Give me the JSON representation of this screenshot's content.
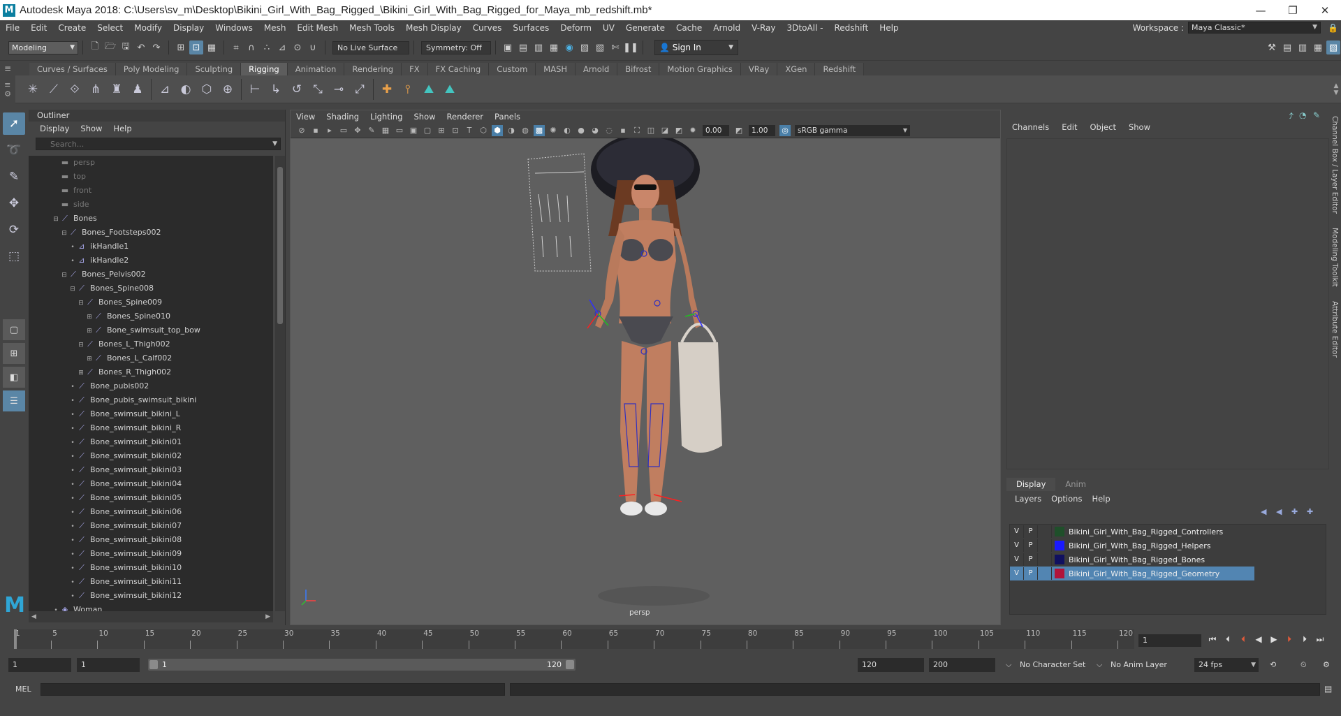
{
  "window": {
    "title": "Autodesk Maya 2018: C:\\Users\\sv_m\\Desktop\\Bikini_Girl_With_Bag_Rigged_\\Bikini_Girl_With_Bag_Rigged_for_Maya_mb_redshift.mb*",
    "logo": "M",
    "minimize": "—",
    "restore": "❐",
    "close": "✕"
  },
  "menubar": {
    "items": [
      "File",
      "Edit",
      "Create",
      "Select",
      "Modify",
      "Display",
      "Windows",
      "Mesh",
      "Edit Mesh",
      "Mesh Tools",
      "Mesh Display",
      "Curves",
      "Surfaces",
      "Deform",
      "UV",
      "Generate",
      "Cache",
      "Arnold",
      "V-Ray",
      "3DtoAll -",
      "Redshift",
      "Help"
    ],
    "workspace_label": "Workspace :",
    "workspace_value": "Maya Classic*"
  },
  "statusline": {
    "mode": "Modeling",
    "live_surface": "No Live Surface",
    "symmetry": "Symmetry: Off",
    "sign_in": "Sign In"
  },
  "shelf": {
    "tabs": [
      "Curves / Surfaces",
      "Poly Modeling",
      "Sculpting",
      "Rigging",
      "Animation",
      "Rendering",
      "FX",
      "FX Caching",
      "Custom",
      "MASH",
      "Arnold",
      "Bifrost",
      "Motion Graphics",
      "VRay",
      "XGen",
      "Redshift"
    ],
    "active_tab": "Rigging"
  },
  "outliner": {
    "title": "Outliner",
    "menu": [
      "Display",
      "Show",
      "Help"
    ],
    "search_placeholder": "Search...",
    "rows": [
      {
        "label": "persp",
        "depth": 0,
        "exp": "",
        "icon": "camera-icon",
        "dim": true
      },
      {
        "label": "top",
        "depth": 0,
        "exp": "",
        "icon": "camera-icon",
        "dim": true
      },
      {
        "label": "front",
        "depth": 0,
        "exp": "",
        "icon": "camera-icon",
        "dim": true
      },
      {
        "label": "side",
        "depth": 0,
        "exp": "",
        "icon": "camera-icon",
        "dim": true
      },
      {
        "label": "Bones",
        "depth": 0,
        "exp": "⊟",
        "icon": "joint-icon",
        "dim": false
      },
      {
        "label": "Bones_Footsteps002",
        "depth": 1,
        "exp": "⊟",
        "icon": "joint-icon",
        "dim": false
      },
      {
        "label": "ikHandle1",
        "depth": 2,
        "exp": "•",
        "icon": "ik-handle-icon",
        "dim": false
      },
      {
        "label": "ikHandle2",
        "depth": 2,
        "exp": "•",
        "icon": "ik-handle-icon",
        "dim": false
      },
      {
        "label": "Bones_Pelvis002",
        "depth": 1,
        "exp": "⊟",
        "icon": "joint-icon",
        "dim": false
      },
      {
        "label": "Bones_Spine008",
        "depth": 2,
        "exp": "⊟",
        "icon": "joint-icon",
        "dim": false
      },
      {
        "label": "Bones_Spine009",
        "depth": 3,
        "exp": "⊟",
        "icon": "joint-icon",
        "dim": false
      },
      {
        "label": "Bones_Spine010",
        "depth": 4,
        "exp": "⊞",
        "icon": "joint-icon",
        "dim": false
      },
      {
        "label": "Bone_swimsuit_top_bow",
        "depth": 4,
        "exp": "⊞",
        "icon": "joint-icon",
        "dim": false
      },
      {
        "label": "Bones_L_Thigh002",
        "depth": 3,
        "exp": "⊟",
        "icon": "joint-icon",
        "dim": false
      },
      {
        "label": "Bones_L_Calf002",
        "depth": 4,
        "exp": "⊞",
        "icon": "joint-icon",
        "dim": false
      },
      {
        "label": "Bones_R_Thigh002",
        "depth": 3,
        "exp": "⊞",
        "icon": "joint-icon",
        "dim": false
      },
      {
        "label": "Bone_pubis002",
        "depth": 2,
        "exp": "•",
        "icon": "joint-icon",
        "dim": false
      },
      {
        "label": "Bone_pubis_swimsuit_bikini",
        "depth": 2,
        "exp": "•",
        "icon": "joint-icon",
        "dim": false
      },
      {
        "label": "Bone_swimsuit_bikini_L",
        "depth": 2,
        "exp": "•",
        "icon": "joint-icon",
        "dim": false
      },
      {
        "label": "Bone_swimsuit_bikini_R",
        "depth": 2,
        "exp": "•",
        "icon": "joint-icon",
        "dim": false
      },
      {
        "label": "Bone_swimsuit_bikini01",
        "depth": 2,
        "exp": "•",
        "icon": "joint-icon",
        "dim": false
      },
      {
        "label": "Bone_swimsuit_bikini02",
        "depth": 2,
        "exp": "•",
        "icon": "joint-icon",
        "dim": false
      },
      {
        "label": "Bone_swimsuit_bikini03",
        "depth": 2,
        "exp": "•",
        "icon": "joint-icon",
        "dim": false
      },
      {
        "label": "Bone_swimsuit_bikini04",
        "depth": 2,
        "exp": "•",
        "icon": "joint-icon",
        "dim": false
      },
      {
        "label": "Bone_swimsuit_bikini05",
        "depth": 2,
        "exp": "•",
        "icon": "joint-icon",
        "dim": false
      },
      {
        "label": "Bone_swimsuit_bikini06",
        "depth": 2,
        "exp": "•",
        "icon": "joint-icon",
        "dim": false
      },
      {
        "label": "Bone_swimsuit_bikini07",
        "depth": 2,
        "exp": "•",
        "icon": "joint-icon",
        "dim": false
      },
      {
        "label": "Bone_swimsuit_bikini08",
        "depth": 2,
        "exp": "•",
        "icon": "joint-icon",
        "dim": false
      },
      {
        "label": "Bone_swimsuit_bikini09",
        "depth": 2,
        "exp": "•",
        "icon": "joint-icon",
        "dim": false
      },
      {
        "label": "Bone_swimsuit_bikini10",
        "depth": 2,
        "exp": "•",
        "icon": "joint-icon",
        "dim": false
      },
      {
        "label": "Bone_swimsuit_bikini11",
        "depth": 2,
        "exp": "•",
        "icon": "joint-icon",
        "dim": false
      },
      {
        "label": "Bone_swimsuit_bikini12",
        "depth": 2,
        "exp": "•",
        "icon": "joint-icon",
        "dim": false
      },
      {
        "label": "Woman",
        "depth": 0,
        "exp": "•",
        "icon": "mesh-icon",
        "dim": false
      }
    ]
  },
  "viewport": {
    "menu": [
      "View",
      "Shading",
      "Lighting",
      "Show",
      "Renderer",
      "Panels"
    ],
    "exposure": "0.00",
    "gamma": "1.00",
    "color_space": "sRGB gamma",
    "camera": "persp"
  },
  "channelbox": {
    "menu": [
      "Channels",
      "Edit",
      "Object",
      "Show"
    ],
    "side_tabs": [
      "Channel Box / Layer Editor",
      "Modeling Toolkit",
      "Attribute Editor"
    ]
  },
  "layer_editor": {
    "tabs": [
      "Display",
      "Anim"
    ],
    "active_tab": "Display",
    "menu": [
      "Layers",
      "Options",
      "Help"
    ],
    "layers": [
      {
        "v": "V",
        "p": "P",
        "color": "#1f4f2a",
        "name": "Bikini_Girl_With_Bag_Rigged_Controllers",
        "selected": false
      },
      {
        "v": "V",
        "p": "P",
        "color": "#1a1aff",
        "name": "Bikini_Girl_With_Bag_Rigged_Helpers",
        "selected": false
      },
      {
        "v": "V",
        "p": "P",
        "color": "#101060",
        "name": "Bikini_Girl_With_Bag_Rigged_Bones",
        "selected": false
      },
      {
        "v": "V",
        "p": "P",
        "color": "#b0143a",
        "name": "Bikini_Girl_With_Bag_Rigged_Geometry",
        "selected": true
      }
    ]
  },
  "timeslider": {
    "start_tick": "1",
    "ticks": [
      "5",
      "10",
      "15",
      "20",
      "25",
      "30",
      "35",
      "40",
      "45",
      "50",
      "55",
      "60",
      "65",
      "70",
      "75",
      "80",
      "85",
      "90",
      "95",
      "100",
      "105",
      "110",
      "115",
      "120"
    ],
    "current_frame": "1"
  },
  "rangeslider": {
    "start": "1",
    "anim_start": "1",
    "range_start": "1",
    "range_end": "120",
    "anim_end": "120",
    "end": "200",
    "character_set": "No Character Set",
    "anim_layer": "No Anim Layer",
    "fps": "24 fps"
  },
  "cmdline": {
    "label": "MEL"
  }
}
